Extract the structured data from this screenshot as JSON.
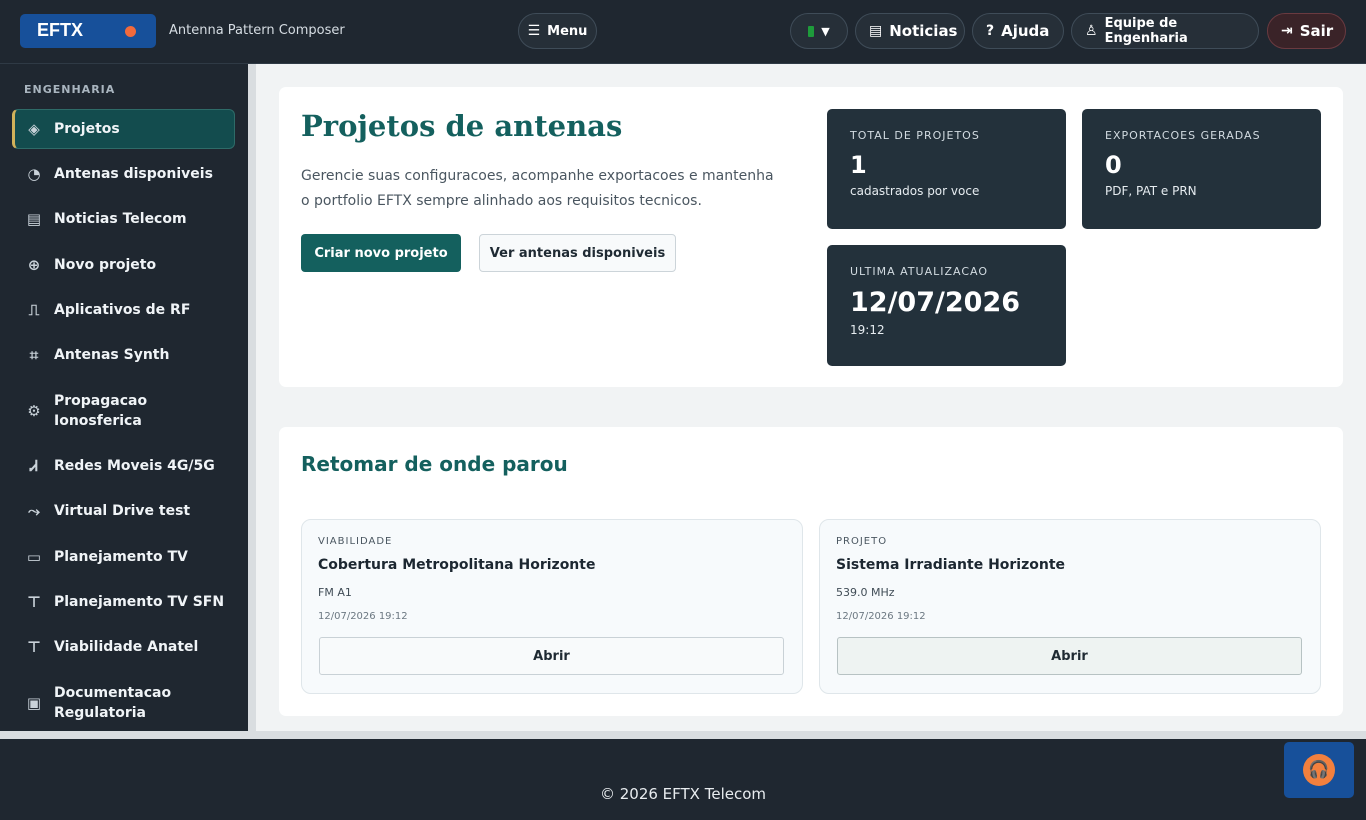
{
  "header": {
    "logo_text": "EFTX",
    "app_subtitle": "Antenna Pattern Composer",
    "menu_label": "Menu",
    "language_flag": "flag-brazil",
    "news_label": "Noticias",
    "help_label": "Ajuda",
    "team_label": "Equipe de Engenharia",
    "logout_label": "Sair"
  },
  "sidebar": {
    "section_title": "ENGENHARIA",
    "items": [
      {
        "label": "Projetos",
        "icon": "layers-icon"
      },
      {
        "label": "Antenas disponiveis",
        "icon": "satellite-dish-icon"
      },
      {
        "label": "Noticias Telecom",
        "icon": "newspaper-icon"
      },
      {
        "label": "Novo projeto",
        "icon": "file-plus-icon"
      },
      {
        "label": "Aplicativos de RF",
        "icon": "pulse-wave-icon"
      },
      {
        "label": "Antenas Synth",
        "icon": "vector-shape-icon"
      },
      {
        "label": "Propagacao Ionosferica",
        "icon": "gear-icon"
      },
      {
        "label": "Redes Moveis 4G/5G",
        "icon": "cell-tower-icon"
      },
      {
        "label": "Virtual Drive test",
        "icon": "route-icon"
      },
      {
        "label": "Planejamento TV",
        "icon": "monitor-icon"
      },
      {
        "label": "Planejamento TV SFN",
        "icon": "broadcast-tower-icon"
      },
      {
        "label": "Viabilidade Anatel",
        "icon": "broadcast-tower-icon"
      },
      {
        "label": "Documentacao Regulatoria",
        "icon": "clipboard-icon"
      }
    ]
  },
  "hero": {
    "title": "Projetos de antenas",
    "description": "Gerencie suas configuracoes, acompanhe exportacoes e mantenha o portfolio EFTX sempre alinhado aos requisitos tecnicos.",
    "primary_button": "Criar novo projeto",
    "secondary_button": "Ver antenas disponiveis"
  },
  "stats": [
    {
      "label": "TOTAL DE PROJETOS",
      "value": "1",
      "sub": "cadastrados por voce"
    },
    {
      "label": "EXPORTACOES GERADAS",
      "value": "0",
      "sub": "PDF, PAT e PRN"
    },
    {
      "label": "ULTIMA ATUALIZACAO",
      "value": "12/07/2026",
      "sub": "19:12"
    }
  ],
  "resume": {
    "title": "Retomar de onde parou",
    "items": [
      {
        "kind": "VIABILIDADE",
        "name": "Cobertura Metropolitana Horizonte",
        "band": "FM A1",
        "time": "12/07/2026 19:12",
        "action": "Abrir"
      },
      {
        "kind": "PROJETO",
        "name": "Sistema Irradiante Horizonte",
        "band": "539.0 MHz",
        "time": "12/07/2026 19:12",
        "action": "Abrir"
      }
    ]
  },
  "footer": {
    "copyright": "© 2026 EFTX Telecom",
    "support_icon": "headset-icon"
  },
  "colors": {
    "brand": "#17509a",
    "accent": "#14605e",
    "dark_bg": "#1f2730",
    "stat_bg": "#23313b",
    "highlight": "#d1b25a"
  }
}
